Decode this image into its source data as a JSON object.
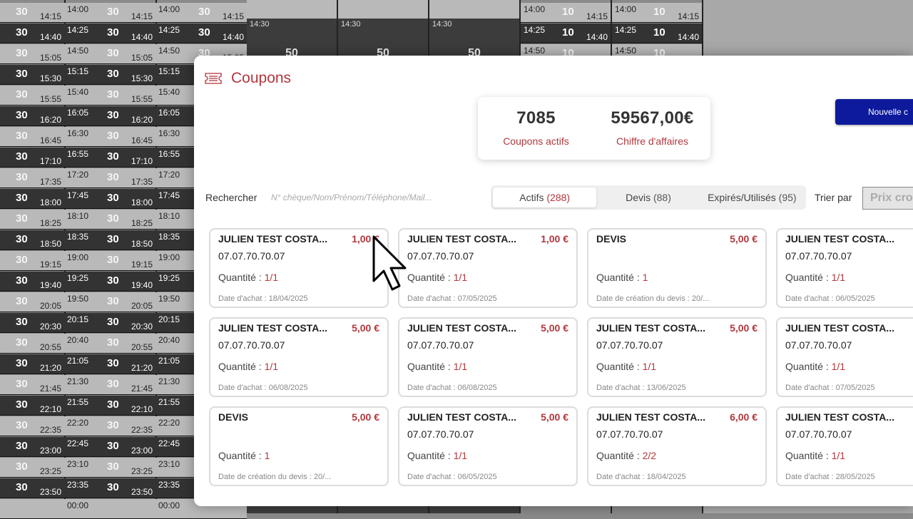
{
  "modal": {
    "title": "Coupons",
    "stats": [
      {
        "value": "7085",
        "label": "Coupons actifs"
      },
      {
        "value": "59567,00€",
        "label": "Chiffre d'affaires"
      }
    ],
    "new_button_label": "Nouvelle c",
    "search": {
      "label": "Rechercher",
      "placeholder": "N° chèque/Nom/Prénom/Téléphone/Mail..."
    },
    "tabs": [
      {
        "label": "Actifs",
        "count": "(288)",
        "active": true
      },
      {
        "label": "Devis",
        "count": "(88)",
        "active": false
      },
      {
        "label": "Expirés/Utilisés",
        "count": "(95)",
        "active": false
      }
    ],
    "sort": {
      "label": "Trier par",
      "value": "Prix cro"
    }
  },
  "coupons": [
    {
      "name": "JULIEN TEST COSTA...",
      "price": "1,00 €",
      "phone": "07.07.70.70.07",
      "qty_label": "Quantité :",
      "qty": "1/1",
      "date": "Date d'achat : 18/04/2025"
    },
    {
      "name": "JULIEN TEST COSTA...",
      "price": "1,00 €",
      "phone": "07.07.70.70.07",
      "qty_label": "Quantité :",
      "qty": "1/1",
      "date": "Date d'achat : 07/05/2025"
    },
    {
      "name": "DEVIS",
      "price": "5,00 €",
      "phone": "",
      "qty_label": "Quantité :",
      "qty": "1",
      "date": "Date de création du devis : 20/..."
    },
    {
      "name": "JULIEN TEST COSTA...",
      "price": "",
      "phone": "07.07.70.70.07",
      "qty_label": "Quantité :",
      "qty": "1/1",
      "date": "Date d'achat : 06/05/2025"
    },
    {
      "name": "JULIEN TEST COSTA...",
      "price": "5,00 €",
      "phone": "07.07.70.70.07",
      "qty_label": "Quantité :",
      "qty": "1/1",
      "date": "Date d'achat : 06/08/2025"
    },
    {
      "name": "JULIEN TEST COSTA...",
      "price": "5,00 €",
      "phone": "07.07.70.70.07",
      "qty_label": "Quantité :",
      "qty": "1/1",
      "date": "Date d'achat : 06/08/2025"
    },
    {
      "name": "JULIEN TEST COSTA...",
      "price": "5,00 €",
      "phone": "07.07.70.70.07",
      "qty_label": "Quantité :",
      "qty": "1/1",
      "date": "Date d'achat : 13/06/2025"
    },
    {
      "name": "JULIEN TEST COSTA...",
      "price": "",
      "phone": "07.07.70.70.07",
      "qty_label": "Quantité :",
      "qty": "1/1",
      "date": "Date d'achat : 07/05/2025"
    },
    {
      "name": "DEVIS",
      "price": "5,00 €",
      "phone": "",
      "qty_label": "Quantité :",
      "qty": "1",
      "date": "Date de création du devis : 20/..."
    },
    {
      "name": "JULIEN TEST COSTA...",
      "price": "5,00 €",
      "phone": "07.07.70.70.07",
      "qty_label": "Quantité :",
      "qty": "1/1",
      "date": "Date d'achat : 06/05/2025"
    },
    {
      "name": "JULIEN TEST COSTA...",
      "price": "6,00 €",
      "phone": "07.07.70.70.07",
      "qty_label": "Quantité :",
      "qty": "2/2",
      "date": "Date d'achat : 18/04/2025"
    },
    {
      "name": "JULIEN TEST COSTA...",
      "price": "",
      "phone": "07.07.70.70.07",
      "qty_label": "Quantité :",
      "qty": "1/1",
      "date": "Date d'achat : 28/05/2025"
    }
  ],
  "background": {
    "slots": [
      {
        "start": "14:00",
        "end": "14:15",
        "places": "30",
        "light": true
      },
      {
        "start": "14:25",
        "end": "14:40",
        "places": "30",
        "light": false
      },
      {
        "start": "14:50",
        "end": "15:05",
        "places": "30",
        "light": true
      },
      {
        "start": "15:15",
        "end": "15:30",
        "places": "30",
        "light": false
      },
      {
        "start": "15:40",
        "end": "15:55",
        "places": "30",
        "light": true
      },
      {
        "start": "16:05",
        "end": "16:20",
        "places": "30",
        "light": false
      },
      {
        "start": "16:30",
        "end": "16:45",
        "places": "30",
        "light": true
      },
      {
        "start": "16:55",
        "end": "17:10",
        "places": "30",
        "light": false
      },
      {
        "start": "17:20",
        "end": "17:35",
        "places": "30",
        "light": true
      },
      {
        "start": "17:45",
        "end": "18:00",
        "places": "30",
        "light": false
      },
      {
        "start": "18:10",
        "end": "18:25",
        "places": "30",
        "light": true
      },
      {
        "start": "18:35",
        "end": "18:50",
        "places": "30",
        "light": false
      },
      {
        "start": "19:00",
        "end": "19:15",
        "places": "30",
        "light": true
      },
      {
        "start": "19:25",
        "end": "19:40",
        "places": "30",
        "light": false
      },
      {
        "start": "19:50",
        "end": "20:05",
        "places": "30",
        "light": true
      },
      {
        "start": "20:15",
        "end": "20:30",
        "places": "30",
        "light": false
      },
      {
        "start": "20:40",
        "end": "20:55",
        "places": "30",
        "light": true
      },
      {
        "start": "21:05",
        "end": "21:20",
        "places": "30",
        "light": false
      },
      {
        "start": "21:30",
        "end": "21:45",
        "places": "30",
        "light": true
      },
      {
        "start": "21:55",
        "end": "22:10",
        "places": "30",
        "light": false
      },
      {
        "start": "22:20",
        "end": "22:35",
        "places": "30",
        "light": true
      },
      {
        "start": "22:45",
        "end": "23:00",
        "places": "30",
        "light": false
      },
      {
        "start": "23:10",
        "end": "23:25",
        "places": "30",
        "light": true
      },
      {
        "start": "23:35",
        "end": "23:50",
        "places": "30",
        "light": false
      },
      {
        "start": "00:00",
        "end": "",
        "places": "",
        "light": true
      }
    ],
    "blocks": [
      {
        "start": "14:30",
        "places": "50"
      },
      {
        "start": "14:30",
        "places": "50"
      },
      {
        "start": "14:30",
        "places": "50"
      }
    ],
    "right_slots": [
      {
        "start": "14:00",
        "end": "14:15",
        "places": "10",
        "light": true
      },
      {
        "start": "14:25",
        "end": "14:40",
        "places": "10",
        "light": false
      },
      {
        "start": "14:50",
        "end": "",
        "places": "10",
        "light": true
      }
    ]
  }
}
